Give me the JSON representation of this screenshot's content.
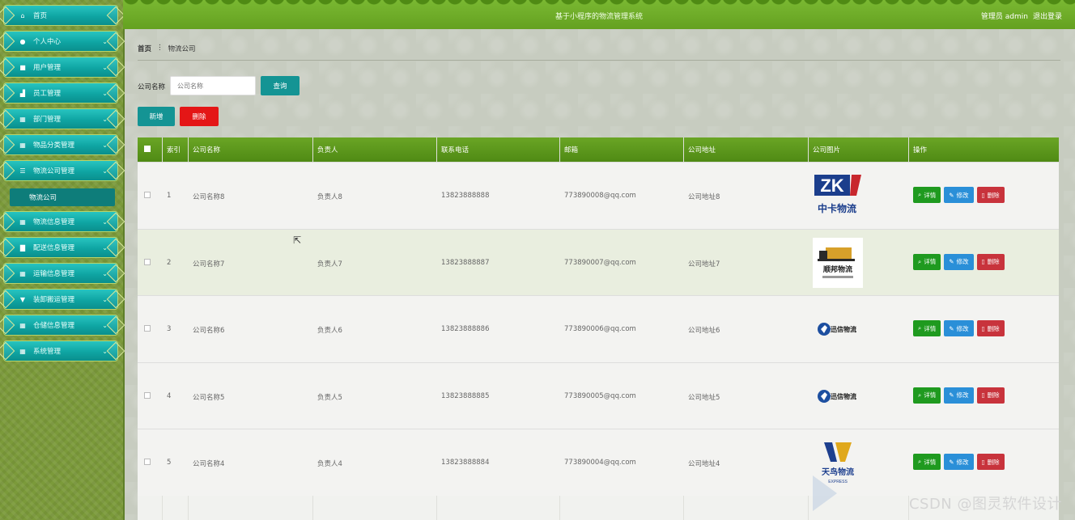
{
  "sidebar": {
    "items": [
      {
        "label": "首页",
        "icon": "home-icon",
        "glyph": "⌂"
      },
      {
        "label": "个人中心",
        "icon": "user-icon",
        "glyph": "●"
      },
      {
        "label": "用户管理",
        "icon": "users-icon",
        "glyph": "■"
      },
      {
        "label": "员工管理",
        "icon": "chart-icon",
        "glyph": "▟"
      },
      {
        "label": "部门管理",
        "icon": "grid-icon",
        "glyph": "▦"
      },
      {
        "label": "物品分类管理",
        "icon": "grid-icon",
        "glyph": "▦"
      },
      {
        "label": "物流公司管理",
        "icon": "sliders-icon",
        "glyph": "☰"
      },
      {
        "label": "物流信息管理",
        "icon": "grid-icon",
        "glyph": "▦"
      },
      {
        "label": "配送信息管理",
        "icon": "chart-icon",
        "glyph": "▇"
      },
      {
        "label": "运输信息管理",
        "icon": "grid-icon",
        "glyph": "▦"
      },
      {
        "label": "装卸搬运管理",
        "icon": "filter-icon",
        "glyph": "▼"
      },
      {
        "label": "仓储信息管理",
        "icon": "grid-icon",
        "glyph": "▦"
      },
      {
        "label": "系统管理",
        "icon": "grid-icon",
        "glyph": "▦"
      }
    ],
    "active_sub": "物流公司"
  },
  "header": {
    "title": "基于小程序的物流管理系统",
    "user": "管理员 admin",
    "logout": "退出登录"
  },
  "breadcrumb": {
    "home": "首页",
    "sep": "⋮",
    "current": "物流公司"
  },
  "search": {
    "label": "公司名称",
    "placeholder": "公司名称",
    "query_button": "查询"
  },
  "actions": {
    "add": "新增",
    "delete": "删除"
  },
  "table": {
    "columns": [
      "索引",
      "公司名称",
      "负责人",
      "联系电话",
      "邮箱",
      "公司地址",
      "公司图片",
      "操作"
    ],
    "rows": [
      {
        "index": "1",
        "name": "公司名称8",
        "manager": "负责人8",
        "phone": "13823888888",
        "email": "773890008@qq.com",
        "address": "公司地址8",
        "logo": "zk"
      },
      {
        "index": "2",
        "name": "公司名称7",
        "manager": "负责人7",
        "phone": "13823888887",
        "email": "773890007@qq.com",
        "address": "公司地址7",
        "logo": "truck"
      },
      {
        "index": "3",
        "name": "公司名称6",
        "manager": "负责人6",
        "phone": "13823888886",
        "email": "773890006@qq.com",
        "address": "公司地址6",
        "logo": "xinxin"
      },
      {
        "index": "4",
        "name": "公司名称5",
        "manager": "负责人5",
        "phone": "13823888885",
        "email": "773890005@qq.com",
        "address": "公司地址5",
        "logo": "xinxin"
      },
      {
        "index": "5",
        "name": "公司名称4",
        "manager": "负责人4",
        "phone": "13823888884",
        "email": "773890004@qq.com",
        "address": "公司地址4",
        "logo": "tianniao"
      }
    ],
    "ops": {
      "detail": "详情",
      "edit": "修改",
      "delete": "删除"
    }
  },
  "logos": {
    "zk": {
      "main": "ZK",
      "sub": "中卡物流"
    },
    "truck": {
      "sub": "顺邦物流"
    },
    "xinxin": {
      "sub": "迅信物流"
    },
    "tianniao": {
      "sub": "天鸟物流",
      "tag": "EXPRESS"
    }
  },
  "watermark": "CSDN @图灵软件设计",
  "colors": {
    "topbar": "#6aa525",
    "menu": "#14b1ae",
    "query": "#149494",
    "danger": "#e41616",
    "detail": "#1f9a1f",
    "edit": "#2a8fd8",
    "delete": "#c8333c"
  }
}
